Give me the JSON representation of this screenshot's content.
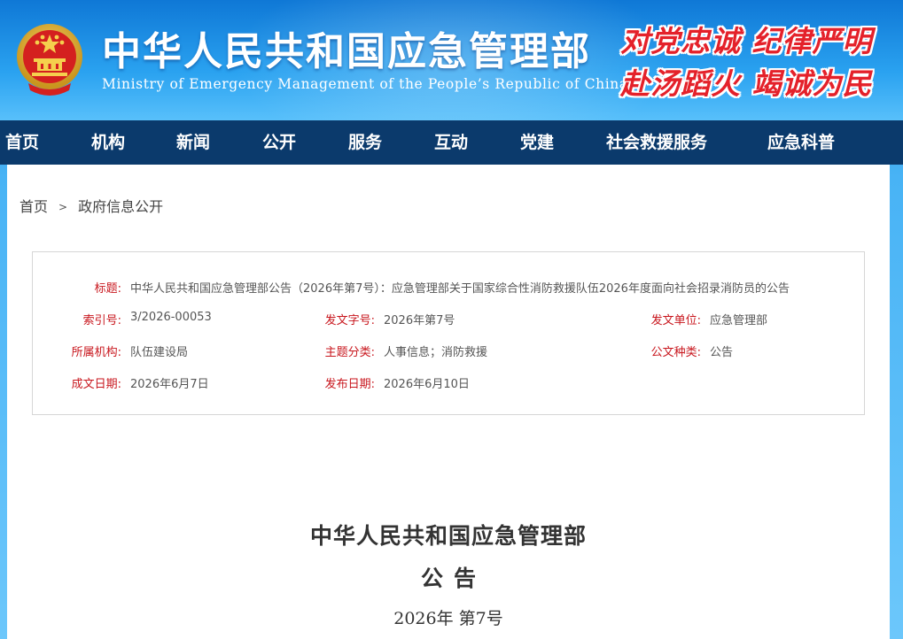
{
  "header": {
    "title": "中华人民共和国应急管理部",
    "subtitle": "Ministry of Emergency Management of the People’s Republic of China",
    "slogan_line1": "对党忠诚  纪律严明",
    "slogan_line2": "赴汤蹈火  竭诚为民",
    "emblem_icon": "national-emblem-icon"
  },
  "nav": {
    "items": [
      "首页",
      "机构",
      "新闻",
      "公开",
      "服务",
      "互动",
      "党建",
      "社会救援服务",
      "应急科普"
    ]
  },
  "breadcrumb": {
    "home": "首页",
    "separator": ">",
    "current": "政府信息公开"
  },
  "meta": {
    "title_label": "标题:",
    "title_value": "中华人民共和国应急管理部公告（2026年第7号）：应急管理部关于国家综合性消防救援队伍2026年度面向社会招录消防员的公告",
    "index_label": "索引号:",
    "index_value": "3/2026-00053",
    "doc_no_label": "发文字号:",
    "doc_no_value": "2026年第7号",
    "issuer_label": "发文单位:",
    "issuer_value": "应急管理部",
    "org_label": "所属机构:",
    "org_value": "队伍建设局",
    "topic_label": "主题分类:",
    "topic_value": "人事信息；消防救援",
    "type_label": "公文种类:",
    "type_value": "公告",
    "created_label": "成文日期:",
    "created_value": "2026年6月7日",
    "published_label": "发布日期:",
    "published_value": "2026年6月10日"
  },
  "document": {
    "heading1": "中华人民共和国应急管理部",
    "heading2": "公告",
    "number": "2026年  第7号"
  },
  "colors": {
    "nav_bg": "#0b3a6c",
    "label_red": "#c8161d",
    "slogan_red": "#e4212a",
    "header_blue": "#1e8ee0"
  }
}
